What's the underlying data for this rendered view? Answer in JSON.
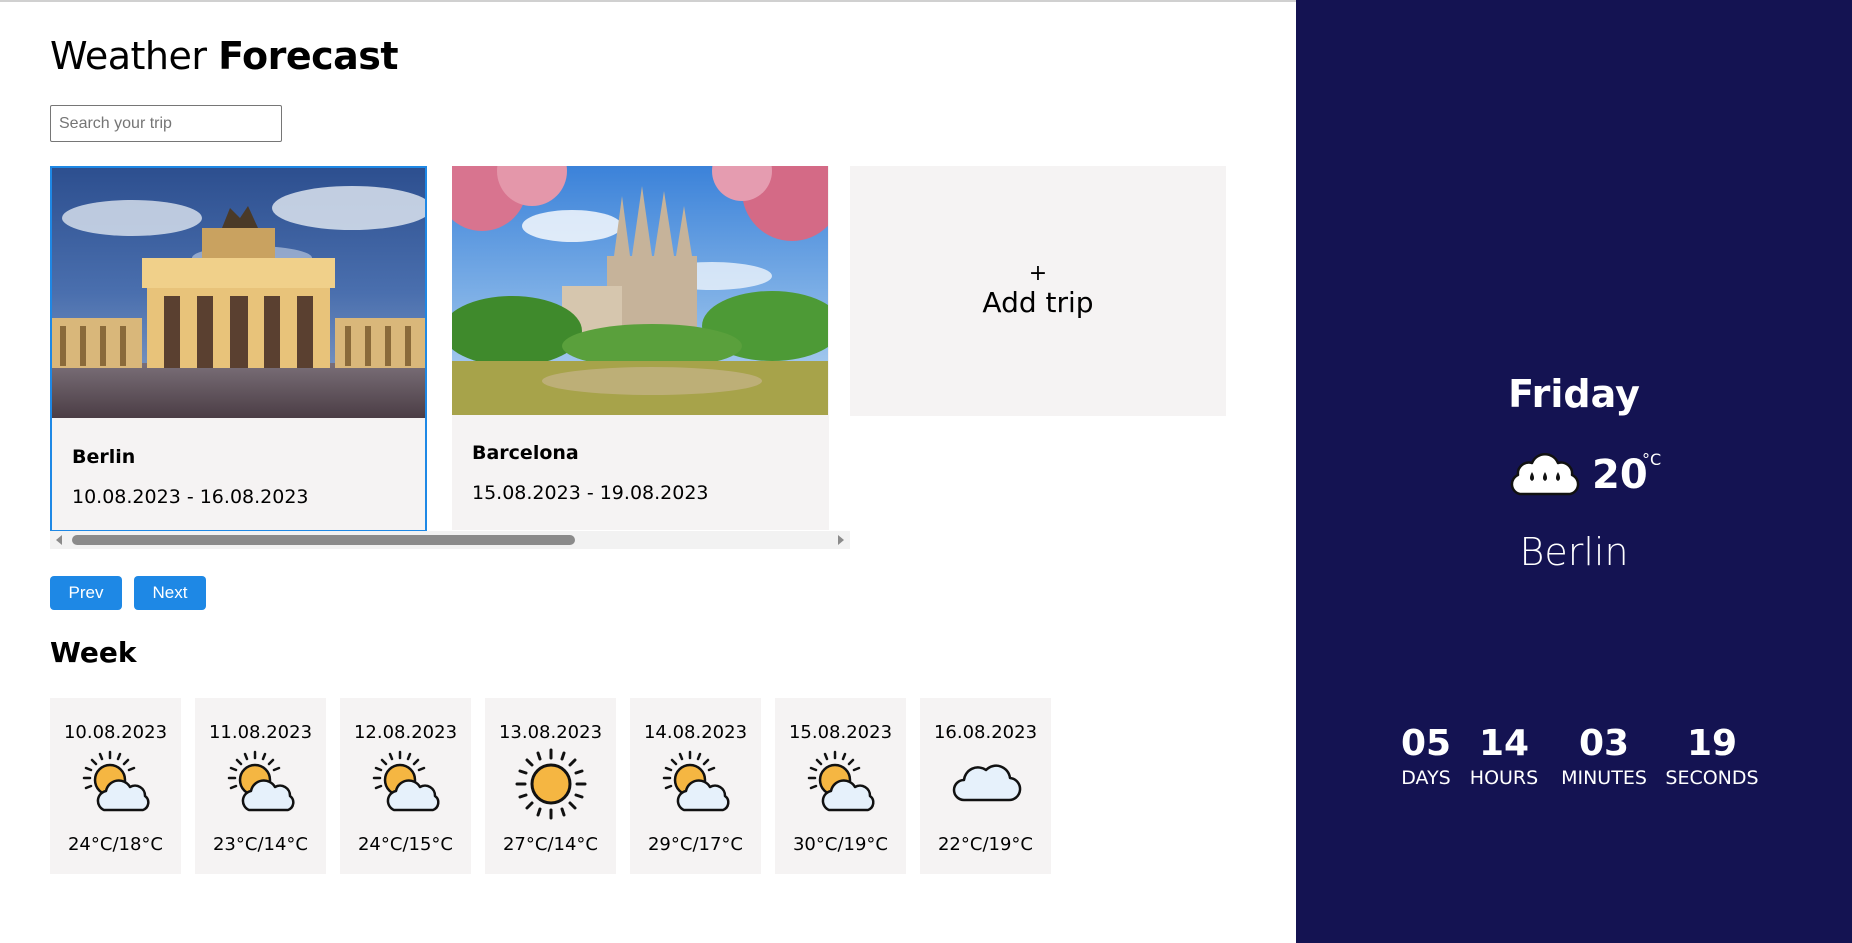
{
  "header": {
    "title_light": "Weather",
    "title_bold": "Forecast"
  },
  "search": {
    "placeholder": "Search your trip",
    "value": ""
  },
  "trips": [
    {
      "city": "Berlin",
      "dates": "10.08.2023 - 16.08.2023",
      "selected": true
    },
    {
      "city": "Barcelona",
      "dates": "15.08.2023 - 19.08.2023",
      "selected": false
    }
  ],
  "add_trip": {
    "plus": "+",
    "label": "Add trip"
  },
  "nav": {
    "prev": "Prev",
    "next": "Next"
  },
  "week": {
    "title": "Week",
    "days": [
      {
        "date": "10.08.2023",
        "icon": "partly-cloudy-icon",
        "temp": "24°C/18°C"
      },
      {
        "date": "11.08.2023",
        "icon": "partly-cloudy-icon",
        "temp": "23°C/14°C"
      },
      {
        "date": "12.08.2023",
        "icon": "partly-cloudy-icon",
        "temp": "24°C/15°C"
      },
      {
        "date": "13.08.2023",
        "icon": "sun-icon",
        "temp": "27°C/14°C"
      },
      {
        "date": "14.08.2023",
        "icon": "partly-cloudy-icon",
        "temp": "29°C/17°C"
      },
      {
        "date": "15.08.2023",
        "icon": "partly-cloudy-icon",
        "temp": "30°C/19°C"
      },
      {
        "date": "16.08.2023",
        "icon": "cloud-icon",
        "temp": "22°C/19°C"
      }
    ]
  },
  "today": {
    "day": "Friday",
    "icon": "rain-cloud-icon",
    "temp": "20",
    "unit": "°C",
    "city": "Berlin"
  },
  "countdown": {
    "days": "05",
    "days_label": "DAYS",
    "hours": "14",
    "hours_label": "HOURS",
    "minutes": "03",
    "minutes_label": "MINUTES",
    "seconds": "19",
    "seconds_label": "SECONDS"
  },
  "colors": {
    "accent": "#1e88e5",
    "panel": "#141352",
    "card": "#f5f3f3"
  }
}
